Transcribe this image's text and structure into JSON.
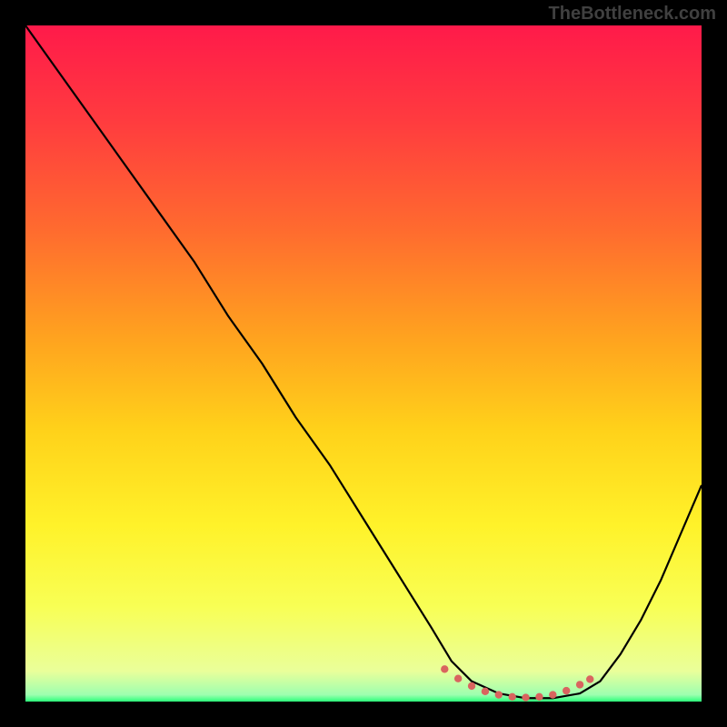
{
  "watermark": "TheBottleneck.com",
  "chart_data": {
    "type": "line",
    "title": "",
    "xlabel": "",
    "ylabel": "",
    "xlim": [
      0,
      100
    ],
    "ylim": [
      0,
      100
    ],
    "gradient_stops": [
      {
        "offset": 0,
        "color": "#ff1a4a"
      },
      {
        "offset": 0.14,
        "color": "#ff3b3f"
      },
      {
        "offset": 0.3,
        "color": "#ff6a2f"
      },
      {
        "offset": 0.46,
        "color": "#ffa21f"
      },
      {
        "offset": 0.6,
        "color": "#ffd21a"
      },
      {
        "offset": 0.74,
        "color": "#fff22a"
      },
      {
        "offset": 0.86,
        "color": "#f8ff55"
      },
      {
        "offset": 0.955,
        "color": "#eaff9a"
      },
      {
        "offset": 0.99,
        "color": "#9dffb0"
      },
      {
        "offset": 1.0,
        "color": "#2bff7a"
      }
    ],
    "series": [
      {
        "name": "bottleneck-curve",
        "color": "#000000",
        "width": 2.2,
        "x": [
          0,
          5,
          10,
          15,
          20,
          25,
          30,
          35,
          40,
          45,
          50,
          55,
          60,
          63,
          66,
          70,
          74,
          78,
          82,
          85,
          88,
          91,
          94,
          97,
          100
        ],
        "y": [
          100,
          93,
          86,
          79,
          72,
          65,
          57,
          50,
          42,
          35,
          27,
          19,
          11,
          6,
          3,
          1.2,
          0.5,
          0.5,
          1.2,
          3,
          7,
          12,
          18,
          25,
          32
        ]
      }
    ],
    "valley_marker": {
      "color": "#d9645f",
      "radius": 4.2,
      "x": [
        62,
        64,
        66,
        68,
        70,
        72,
        74,
        76,
        78,
        80,
        82,
        83.5
      ],
      "y": [
        4.8,
        3.4,
        2.3,
        1.5,
        1.0,
        0.7,
        0.6,
        0.7,
        1.0,
        1.6,
        2.5,
        3.3
      ]
    }
  }
}
